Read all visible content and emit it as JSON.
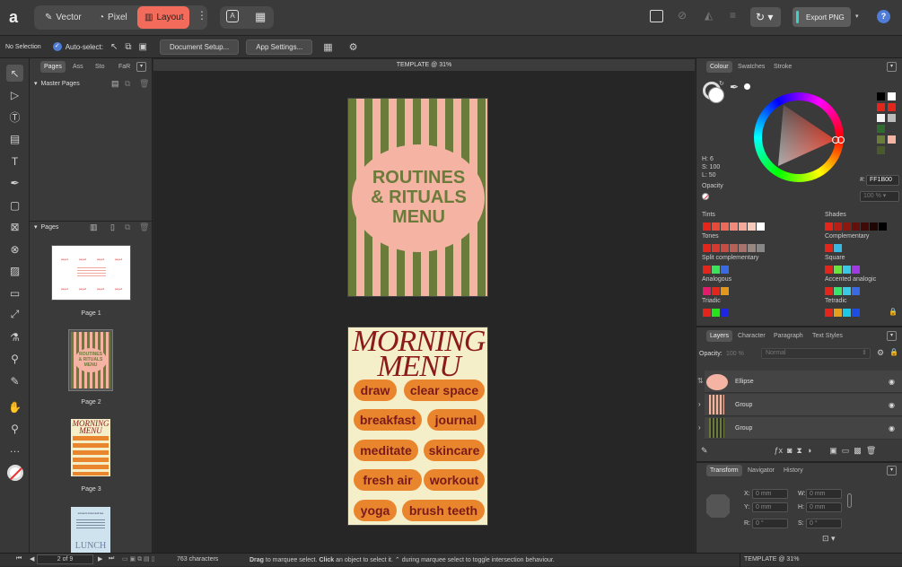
{
  "toolbar": {
    "personas": {
      "vector": "Vector",
      "pixel": "Pixel",
      "layout": "Layout"
    },
    "export_label": "Export PNG",
    "help": "?"
  },
  "context": {
    "selection": "No Selection",
    "autoselect": "Auto-select:",
    "doc_setup": "Document Setup...",
    "app_settings": "App Settings..."
  },
  "left_panel": {
    "tabs": [
      "Pages",
      "Ass",
      "Sto",
      "FaR"
    ],
    "master_pages": "Master Pages",
    "pages_header": "Pages",
    "pages": [
      "Page 1",
      "Page 2",
      "Page 3"
    ]
  },
  "document": {
    "title": "TEMPLATE @ 31%",
    "page2": {
      "line1": "ROUTINES",
      "line2": "& RITUALS",
      "line3": "MENU"
    },
    "page3": {
      "title1": "MORNING",
      "title2": "MENU",
      "items": [
        "draw",
        "clear space",
        "breakfast",
        "journal",
        "meditate",
        "skincare",
        "fresh air",
        "workout",
        "yoga",
        "brush teeth"
      ]
    },
    "page1_text": {
      "cols": [
        "page1",
        "page2",
        "page3",
        "page4"
      ]
    },
    "page4_text": {
      "l1": "scissors bowl and tee",
      "big": "LUNCH"
    }
  },
  "colour_panel": {
    "tabs": [
      "Colour",
      "Swatches",
      "Stroke"
    ],
    "h": "H: 6",
    "s": "S: 100",
    "l": "L: 50",
    "hex_label": "#:",
    "hex": "FF1B00",
    "opacity_label": "Opacity",
    "opacity_value": "100 %",
    "harmonies": {
      "tints": "Tints",
      "shades": "Shades",
      "tones": "Tones",
      "complementary": "Complementary",
      "split": "Split complementary",
      "square": "Square",
      "analogous": "Analogous",
      "accented": "Accented analogic",
      "triadic": "Triadic",
      "tetradic": "Tetradic"
    }
  },
  "layers_panel": {
    "tabs": [
      "Layers",
      "Character",
      "Paragraph",
      "Text Styles"
    ],
    "opacity_label": "Opacity:",
    "opacity_value": "100 %",
    "blend": "Normal",
    "layers": [
      "Ellipse",
      "Group",
      "Group"
    ]
  },
  "transform_panel": {
    "tabs": [
      "Transform",
      "Navigator",
      "History"
    ],
    "x": "X:",
    "y": "Y:",
    "w": "W:",
    "h": "H:",
    "r": "R:",
    "s": "S:",
    "mm": "0 mm",
    "deg": "0 °"
  },
  "status": {
    "page": "2 of 9",
    "chars": "763 characters",
    "drag": "Drag",
    "drag_text": " to marquee select. ",
    "click": "Click",
    "click_text": " an object to select it. ",
    "hint": " during marquee select to toggle intersection behaviour.",
    "right_title": "TEMPLATE @ 31%"
  },
  "colors": {
    "accent": "#f26b5b",
    "olive": "#6b7b3a",
    "pink": "#f4b3a3",
    "orange": "#e9862d",
    "cream": "#f5efc9",
    "crimson": "#8b1a1a"
  }
}
